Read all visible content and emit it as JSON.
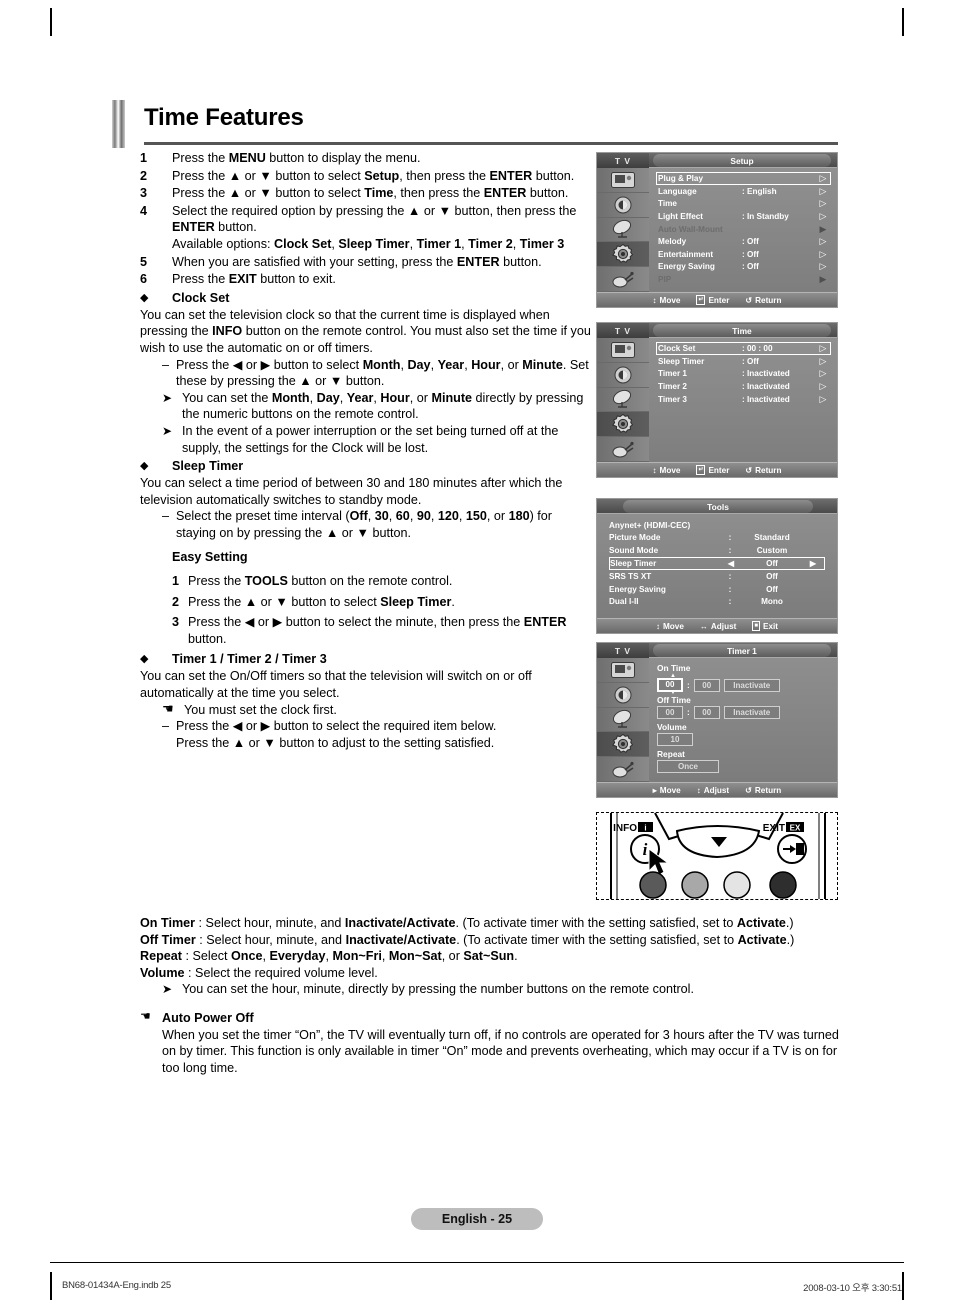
{
  "page": {
    "title": "Time Features",
    "footer_pill": "English - 25",
    "footer_left": "BN68-01434A-Eng.indb   25",
    "footer_right": "2008-03-10   오후 3:30:51"
  },
  "steps": [
    {
      "num": "1",
      "text_html": "Press the <b>MENU</b> button to display the menu."
    },
    {
      "num": "2",
      "text_html": "Press the ▲ or ▼ button to select <b>Setup</b>, then press the <b>ENTER</b> button."
    },
    {
      "num": "3",
      "text_html": "Press the ▲ or ▼ button to select <b>Time</b>, then press the <b>ENTER</b> button."
    },
    {
      "num": "4",
      "text_html": "Select the required option by pressing the ▲ or ▼ button, then press the <b>ENTER</b> button.<br>Available options: <b>Clock Set</b>, <b>Sleep Timer</b>, <b>Timer 1</b>, <b>Timer 2</b>, <b>Timer 3</b>"
    },
    {
      "num": "5",
      "text_html": "When you are satisfied with your setting, press the <b>ENTER</b> button."
    },
    {
      "num": "6",
      "text_html": "Press the <b>EXIT</b> button to exit."
    }
  ],
  "sections": {
    "clock_set": {
      "heading": "Clock Set",
      "para": "You can set the television clock so that the current time is displayed when pressing the <b>INFO</b> button on the remote control. You must also set the time if you wish to use the automatic on or off timers.",
      "dash1": "Press the ◀ or ▶ button to select <b>Month</b>, <b>Day</b>, <b>Year</b>, <b>Hour</b>, or <b>Minute</b>. Set these by pressing the ▲ or ▼ button.",
      "note1": "You can set the <b>Month</b>, <b>Day</b>, <b>Year</b>, <b>Hour</b>, or <b>Minute</b> directly by pressing the numeric buttons on the remote control.",
      "note2": "In the event of a power interruption or the set being turned off at the supply, the settings for the Clock will be lost."
    },
    "sleep_timer": {
      "heading": "Sleep Timer",
      "para": "You can select a time period of between 30 and 180 minutes after which the television automatically switches to standby mode.",
      "dash1": "Select the preset time interval (<b>Off</b>, <b>30</b>, <b>60</b>, <b>90</b>, <b>120</b>, <b>150</b>, or <b>180</b>) for staying on by pressing the ▲ or ▼ button.",
      "easy_setting_heading": "Easy Setting",
      "easy_steps": [
        {
          "num": "1",
          "text_html": "Press the <b>TOOLS</b> button on the remote control."
        },
        {
          "num": "2",
          "text_html": "Press the ▲ or ▼ button to select <b>Sleep Timer</b>."
        },
        {
          "num": "3",
          "text_html": "Press the ◀ or ▶ button to select the minute, then press the <b>ENTER</b> button."
        }
      ]
    },
    "timers": {
      "heading": "Timer 1 / Timer 2 / Timer 3",
      "para": "You can set the On/Off timers so that the television will switch on or off automatically at the time you select.",
      "hand_note": "You must set the clock first.",
      "dash1": "Press the ◀ or ▶ button to select the required item below.<br>Press the ▲ or ▼ button to adjust to the setting satisfied.",
      "on_timer": "<b>On Timer</b> : Select hour, minute, and <b>Inactivate/Activate</b>. (To activate timer with the setting satisfied, set to <b>Activate</b>.)",
      "off_timer": "<b>Off Timer</b> : Select hour, minute, and <b>Inactivate/Activate</b>. (To activate timer with the setting satisfied, set to <b>Activate</b>.)",
      "repeat": "<b>Repeat</b> : Select <b>Once</b>, <b>Everyday</b>, <b>Mon~Fri</b>, <b>Mon~Sat</b>, or <b>Sat~Sun</b>.",
      "volume": "<b>Volume</b> : Select the required volume level.",
      "note": "You can set the hour, minute, directly by pressing the number buttons on the remote control."
    },
    "auto_power_off": {
      "heading": "Auto Power Off",
      "para": "When you set the timer “On”, the TV will eventually turn off, if no controls are operated for 3 hours after the TV was turned on by timer. This function is only available in timer “On” mode and prevents overheating, which may occur if a TV is on for too long time."
    }
  },
  "osd": {
    "tv_label": "T V",
    "footer_move": "Move",
    "footer_enter": "Enter",
    "footer_return": "Return",
    "footer_adjust": "Adjust",
    "footer_exit": "Exit",
    "setup": {
      "title": "Setup",
      "rows": [
        {
          "label": "Plug & Play",
          "value": "",
          "selected": true,
          "dim": false
        },
        {
          "label": "Language",
          "value": ": English",
          "selected": false,
          "dim": false
        },
        {
          "label": "Time",
          "value": "",
          "selected": false,
          "dim": false
        },
        {
          "label": "Light Effect",
          "value": ": In Standby",
          "selected": false,
          "dim": false
        },
        {
          "label": "Auto Wall-Mount",
          "value": "",
          "selected": false,
          "dim": true
        },
        {
          "label": "Melody",
          "value": ": Off",
          "selected": false,
          "dim": false
        },
        {
          "label": "Entertainment",
          "value": ": Off",
          "selected": false,
          "dim": false
        },
        {
          "label": "Energy Saving",
          "value": ": Off",
          "selected": false,
          "dim": false
        },
        {
          "label": "PIP",
          "value": "",
          "selected": false,
          "dim": true
        }
      ]
    },
    "time": {
      "title": "Time",
      "rows": [
        {
          "label": "Clock Set",
          "value": ": 00 : 00",
          "selected": true,
          "dim": false
        },
        {
          "label": "Sleep Timer",
          "value": ": Off",
          "selected": false,
          "dim": false
        },
        {
          "label": "Timer 1",
          "value": ": Inactivated",
          "selected": false,
          "dim": false
        },
        {
          "label": "Timer 2",
          "value": ": Inactivated",
          "selected": false,
          "dim": false
        },
        {
          "label": "Timer 3",
          "value": ": Inactivated",
          "selected": false,
          "dim": false
        }
      ]
    },
    "tools": {
      "title": "Tools",
      "rows": [
        {
          "label": "Anynet+ (HDMI-CEC)",
          "colon": "",
          "value": "",
          "selected": false
        },
        {
          "label": "Picture Mode",
          "colon": ":",
          "value": "Standard",
          "selected": false
        },
        {
          "label": "Sound Mode",
          "colon": ":",
          "value": "Custom",
          "selected": false
        },
        {
          "label": "Sleep Timer",
          "colon": "◀",
          "value": "Off",
          "selected": true
        },
        {
          "label": "SRS TS XT",
          "colon": ":",
          "value": "Off",
          "selected": false
        },
        {
          "label": "Energy Saving",
          "colon": ":",
          "value": "Off",
          "selected": false
        },
        {
          "label": "Dual I-II",
          "colon": ":",
          "value": "Mono",
          "selected": false
        }
      ]
    },
    "timer1": {
      "title": "Timer 1",
      "on_time_label": "On Time",
      "on_hour": "00",
      "on_minute": "00",
      "on_state": "Inactivate",
      "off_time_label": "Off Time",
      "off_hour": "00",
      "off_minute": "00",
      "off_state": "Inactivate",
      "volume_label": "Volume",
      "volume_value": "10",
      "repeat_label": "Repeat",
      "repeat_value": "Once"
    }
  },
  "remote": {
    "info_label": "INFO",
    "exit_label": "EXIT"
  }
}
